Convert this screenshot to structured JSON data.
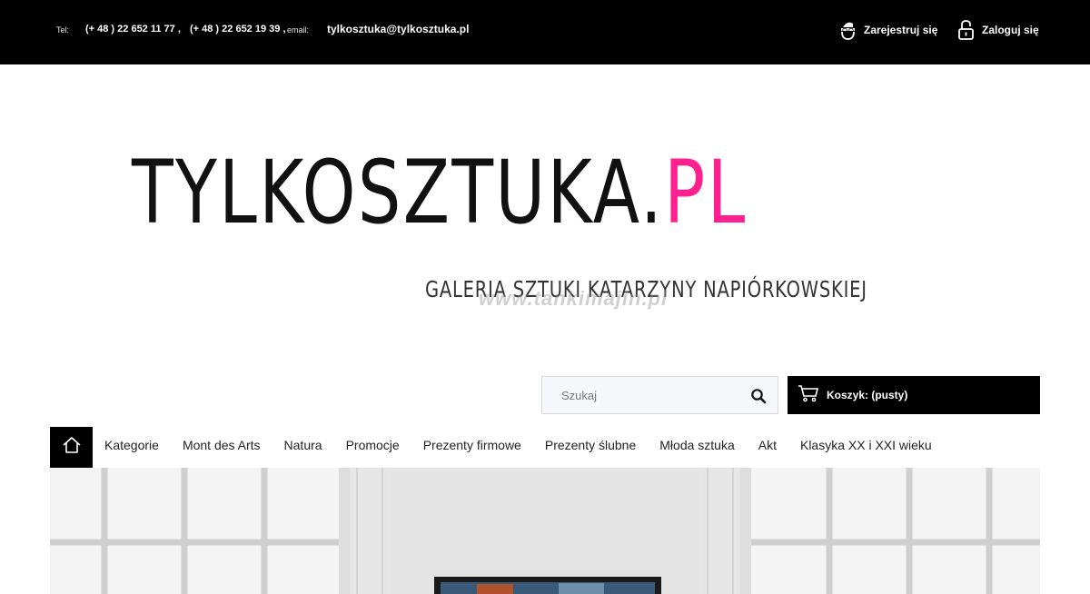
{
  "topbar": {
    "tel_label": "Tel:",
    "phone1": "(+ 48 ) 22 652 11 77 ,",
    "phone2": "(+ 48 ) 22 652 19 39 ,",
    "email_label": "email:",
    "email": "tylkosztuka@tylkosztuka.pl",
    "register_label": "Zarejestruj się",
    "login_label": "Zaloguj się"
  },
  "logo": {
    "main": "TYLKOSZTUKA",
    "dot": ".",
    "pl": "PL",
    "subtitle": "GALERIA SZTUKI KATARZYNY NAPIÓRKOWSKIEJ",
    "watermark": "www.tankimajin.pl"
  },
  "search": {
    "placeholder": "Szukaj"
  },
  "cart": {
    "label": "Koszyk: (pusty)"
  },
  "nav": {
    "items": [
      "Kategorie",
      "Mont des Arts",
      "Natura",
      "Promocje",
      "Prezenty firmowe",
      "Prezenty ślubne",
      "Młoda sztuka",
      "Akt",
      "Klasyka XX i XXI wieku"
    ]
  },
  "colors": {
    "accent": "#ff1f8e",
    "bar": "#000000"
  }
}
